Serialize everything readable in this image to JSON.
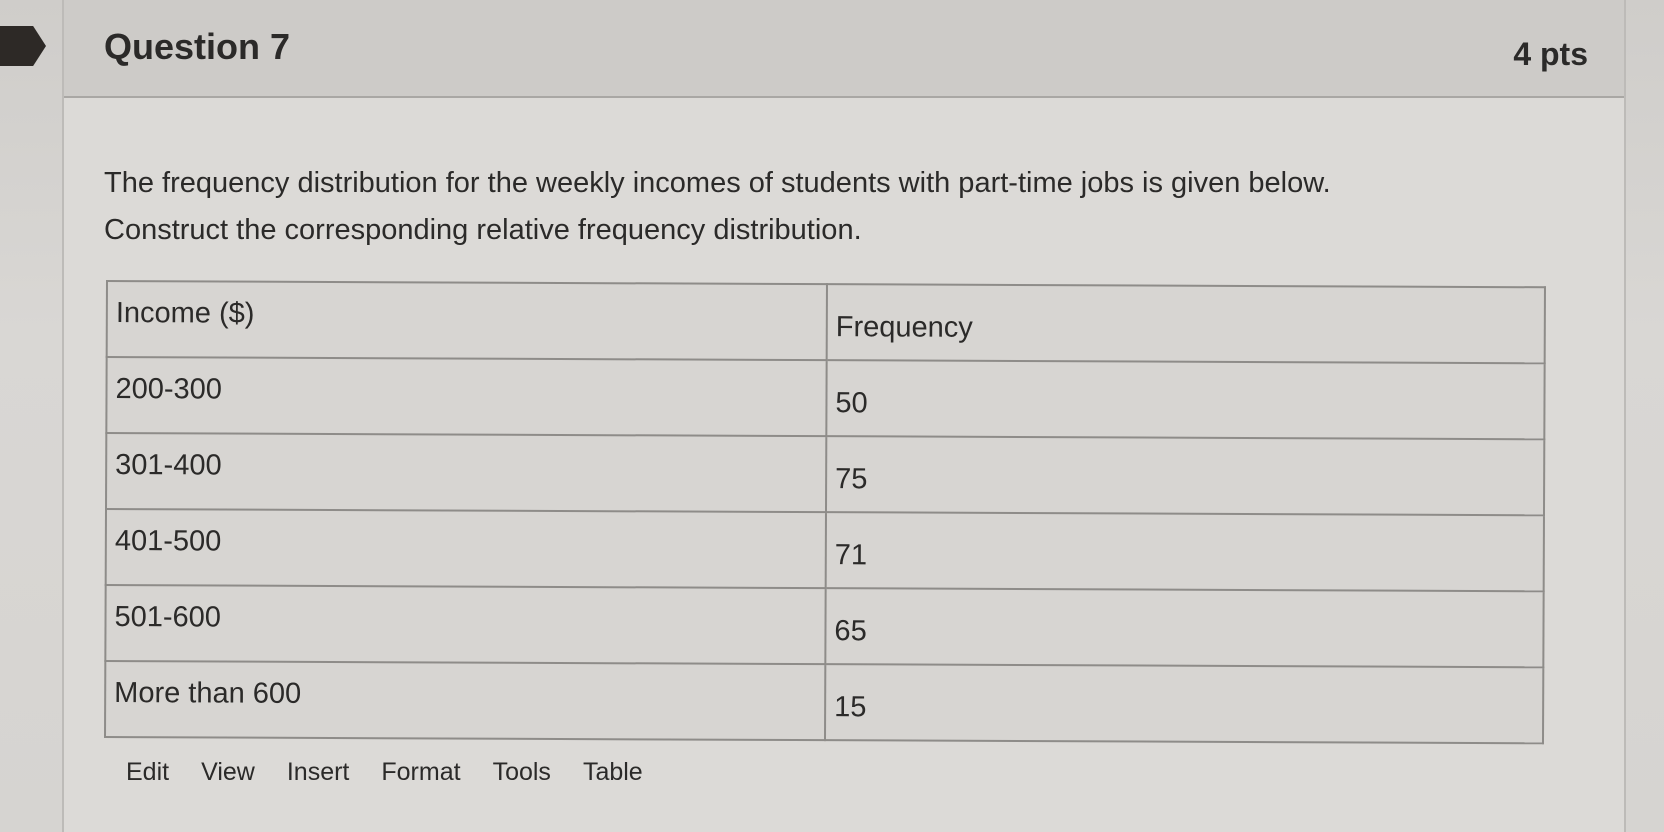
{
  "question": {
    "title": "Question 7",
    "points": "4 pts",
    "prompt_line1": "The frequency distribution for the weekly incomes of students with part-time jobs is given below.",
    "prompt_line2": "Construct the corresponding relative frequency distribution."
  },
  "table": {
    "headers": [
      "Income ($)",
      "Frequency"
    ],
    "rows": [
      [
        "200-300",
        "50"
      ],
      [
        "301-400",
        "75"
      ],
      [
        "401-500",
        "71"
      ],
      [
        "501-600",
        "65"
      ],
      [
        "More than 600",
        "15"
      ]
    ]
  },
  "editor_menu": {
    "items": [
      "Edit",
      "View",
      "Insert",
      "Format",
      "Tools",
      "Table"
    ]
  },
  "colors": {
    "text": "#2b2a29",
    "header_bg": "#cdcbc8",
    "card_bg": "#dcdad7",
    "flag": "#2d2926"
  }
}
